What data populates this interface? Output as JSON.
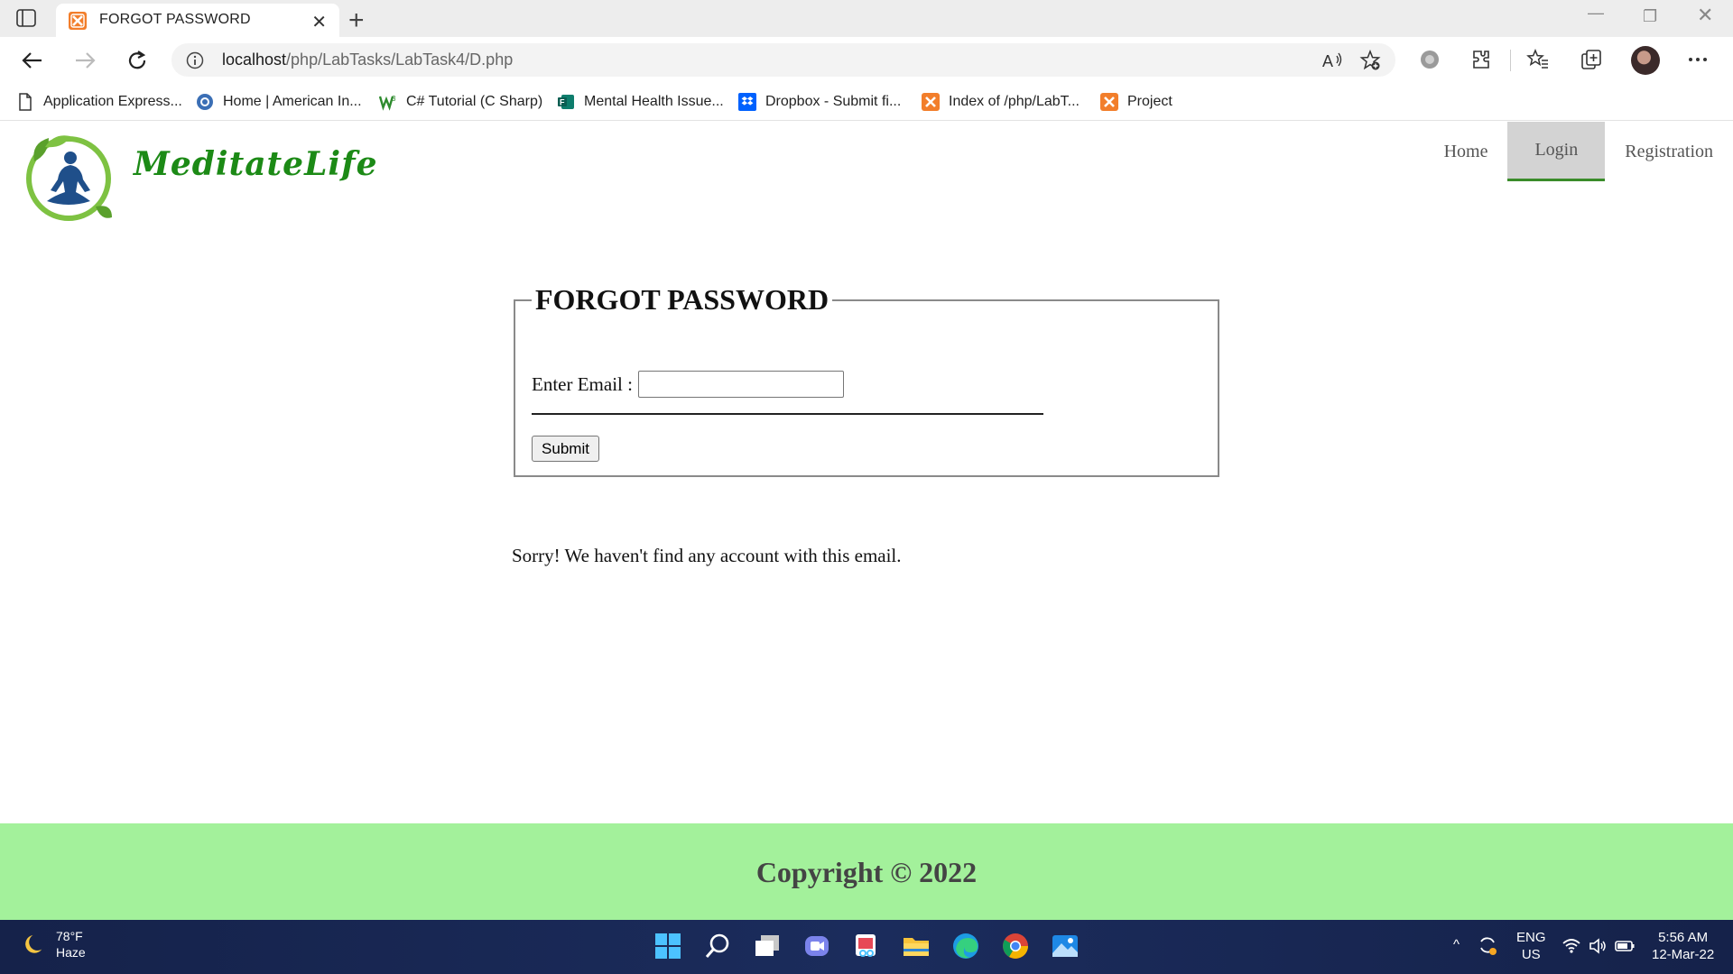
{
  "browser": {
    "tab_title": "FORGOT PASSWORD",
    "url_host": "localhost",
    "url_path": "/php/LabTasks/LabTask4/D.php",
    "bookmarks": [
      {
        "label": "Application Express...",
        "icon": "page-icon"
      },
      {
        "label": "Home | American In...",
        "icon": "globe-icon"
      },
      {
        "label": "C# Tutorial (C Sharp)",
        "icon": "w3-icon"
      },
      {
        "label": "Mental Health Issue...",
        "icon": "forms-icon"
      },
      {
        "label": "Dropbox - Submit fi...",
        "icon": "dropbox-icon"
      },
      {
        "label": "Index of /php/LabT...",
        "icon": "xampp-icon"
      },
      {
        "label": "Project",
        "icon": "xampp-icon"
      }
    ]
  },
  "site": {
    "brand": "MeditateLife",
    "nav": [
      {
        "label": "Home",
        "active": false
      },
      {
        "label": "Login",
        "active": true
      },
      {
        "label": "Registration",
        "active": false
      }
    ]
  },
  "form": {
    "legend": "FORGOT PASSWORD",
    "email_label": "Enter Email :",
    "email_value": "",
    "submit_label": "Submit"
  },
  "message": "Sorry! We haven't find any account with this email.",
  "footer": "Copyright © 2022",
  "taskbar": {
    "weather_temp": "78°F",
    "weather_desc": "Haze",
    "lang": "ENG",
    "region": "US",
    "time": "5:56 AM",
    "date": "12-Mar-22"
  },
  "colors": {
    "brand_green": "#1c8a16",
    "footer_bg": "#a3f19b",
    "nav_active_bg": "#d3d3d3",
    "nav_active_border": "#3a8c2a"
  }
}
